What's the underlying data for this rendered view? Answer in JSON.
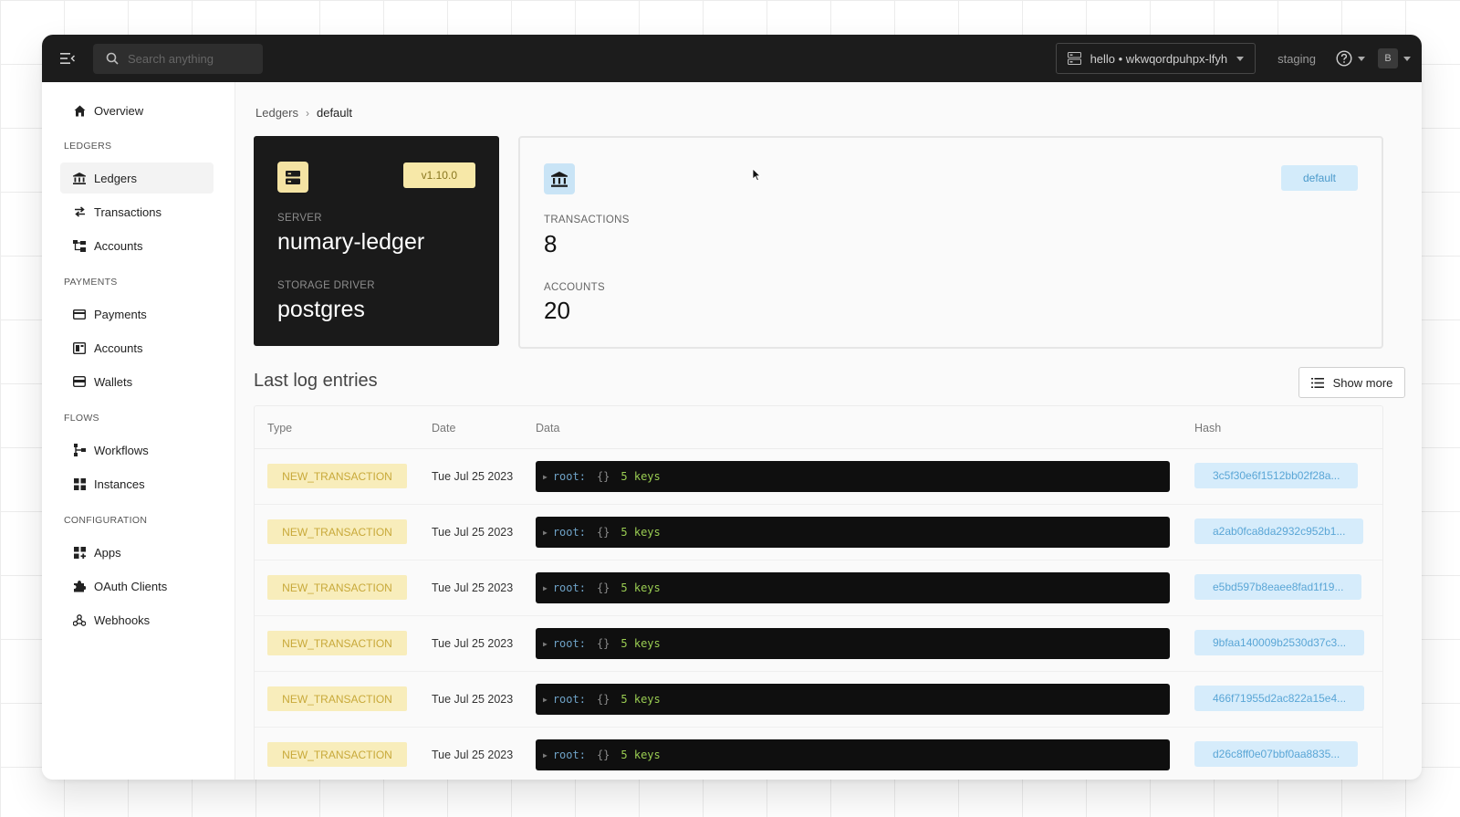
{
  "topbar": {
    "search_placeholder": "Search anything",
    "org_selector": "hello • wkwqordpuhpx-lfyh",
    "environment": "staging",
    "user_initial": "B"
  },
  "sidebar": {
    "overview": "Overview",
    "sections": {
      "ledgers": "LEDGERS",
      "payments": "PAYMENTS",
      "flows": "FLOWS",
      "configuration": "CONFIGURATION"
    },
    "items": {
      "ledgers": "Ledgers",
      "transactions": "Transactions",
      "accounts": "Accounts",
      "payments": "Payments",
      "payment_accounts": "Accounts",
      "wallets": "Wallets",
      "workflows": "Workflows",
      "instances": "Instances",
      "apps": "Apps",
      "oauth_clients": "OAuth Clients",
      "webhooks": "Webhooks"
    },
    "active": "ledgers"
  },
  "breadcrumb": {
    "parent": "Ledgers",
    "separator": "›",
    "current": "default"
  },
  "server_card": {
    "version": "v1.10.0",
    "server_label": "SERVER",
    "server_name": "numary-ledger",
    "storage_label": "STORAGE DRIVER",
    "storage_name": "postgres"
  },
  "ledger_card": {
    "badge": "default",
    "transactions_label": "TRANSACTIONS",
    "transactions_count": "8",
    "accounts_label": "ACCOUNTS",
    "accounts_count": "20"
  },
  "logs": {
    "title": "Last log entries",
    "show_more": "Show more",
    "columns": {
      "type": "Type",
      "date": "Date",
      "data": "Data",
      "hash": "Hash"
    },
    "rows": [
      {
        "type": "NEW_TRANSACTION",
        "date": "Tue Jul 25 2023",
        "json_root": "root:",
        "json_brace": "{}",
        "json_count": "5 keys",
        "hash": "3c5f30e6f1512bb02f28a..."
      },
      {
        "type": "NEW_TRANSACTION",
        "date": "Tue Jul 25 2023",
        "json_root": "root:",
        "json_brace": "{}",
        "json_count": "5 keys",
        "hash": "a2ab0fca8da2932c952b1..."
      },
      {
        "type": "NEW_TRANSACTION",
        "date": "Tue Jul 25 2023",
        "json_root": "root:",
        "json_brace": "{}",
        "json_count": "5 keys",
        "hash": "e5bd597b8eaee8fad1f19..."
      },
      {
        "type": "NEW_TRANSACTION",
        "date": "Tue Jul 25 2023",
        "json_root": "root:",
        "json_brace": "{}",
        "json_count": "5 keys",
        "hash": "9bfaa140009b2530d37c3..."
      },
      {
        "type": "NEW_TRANSACTION",
        "date": "Tue Jul 25 2023",
        "json_root": "root:",
        "json_brace": "{}",
        "json_count": "5 keys",
        "hash": "466f71955d2ac822a15e4..."
      },
      {
        "type": "NEW_TRANSACTION",
        "date": "Tue Jul 25 2023",
        "json_root": "root:",
        "json_brace": "{}",
        "json_count": "5 keys",
        "hash": "d26c8ff0e07bbf0aa8835..."
      }
    ]
  },
  "colors": {
    "topbar": "#1c1c1c",
    "type_badge_bg": "#f8edbb",
    "hash_badge_bg": "#d6ecfb",
    "json_bg": "#0f0f0f"
  }
}
